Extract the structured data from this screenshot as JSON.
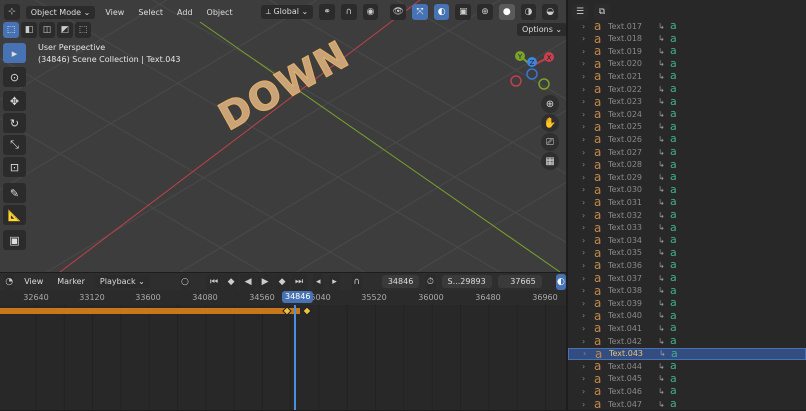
{
  "viewport": {
    "mode": "Object Mode",
    "menus": [
      "View",
      "Select",
      "Add",
      "Object"
    ],
    "orientation": "Global",
    "options_label": "Options",
    "info_line1": "User Perspective",
    "info_line2": "(34846) Scene Collection | Text.043",
    "object_text": "DOWN",
    "gizmo": {
      "x": "X",
      "y": "Y",
      "z": "Z"
    }
  },
  "timeline": {
    "menus": [
      "View",
      "Marker"
    ],
    "playback": "Playback",
    "current_frame": "34846",
    "start_label": "S...",
    "start": "29893",
    "end": "37665",
    "ticks": [
      "32640",
      "33120",
      "33600",
      "34080",
      "34560",
      "35040",
      "35520",
      "36000",
      "36480",
      "36960"
    ],
    "playhead": "34846"
  },
  "outliner": {
    "items": [
      "Text.017",
      "Text.018",
      "Text.019",
      "Text.020",
      "Text.021",
      "Text.022",
      "Text.023",
      "Text.024",
      "Text.025",
      "Text.026",
      "Text.027",
      "Text.028",
      "Text.029",
      "Text.030",
      "Text.031",
      "Text.032",
      "Text.033",
      "Text.034",
      "Text.035",
      "Text.036",
      "Text.037",
      "Text.038",
      "Text.039",
      "Text.040",
      "Text.041",
      "Text.042",
      "Text.043",
      "Text.044",
      "Text.045",
      "Text.046",
      "Text.047"
    ],
    "selected": "Text.043"
  },
  "colors": {
    "accent": "#4772b3",
    "keyframe_bar": "#c8781a",
    "x_axis": "#c0404c",
    "y_axis": "#7aa32a"
  }
}
